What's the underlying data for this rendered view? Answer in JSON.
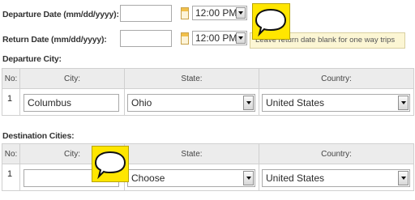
{
  "departure_date": {
    "label": "Departure Date (mm/dd/yyyy):",
    "value": "",
    "time": "12:00 PM"
  },
  "return_date": {
    "label": "Return Date (mm/dd/yyyy):",
    "value": "",
    "time": "12:00 PM",
    "hint": "Leave return date blank for one way trips"
  },
  "departure_city": {
    "title": "Departure City:",
    "headers": [
      "No:",
      "City:",
      "State:",
      "Country:"
    ],
    "row": {
      "no": "1",
      "city": "Columbus",
      "state": "Ohio",
      "country": "United States"
    }
  },
  "destination_cities": {
    "title": "Destination Cities:",
    "headers": [
      "No:",
      "City:",
      "State:",
      "Country:"
    ],
    "row": {
      "no": "1",
      "city": "",
      "state": "Choose",
      "country": "United States"
    }
  },
  "colors": {
    "bubble": "#ffe600",
    "hint_bg": "#fcf6d4",
    "header_bg": "#ececec"
  },
  "icons": [
    "calendar-icon",
    "chevron-down-icon",
    "speech-bubble-icon"
  ]
}
